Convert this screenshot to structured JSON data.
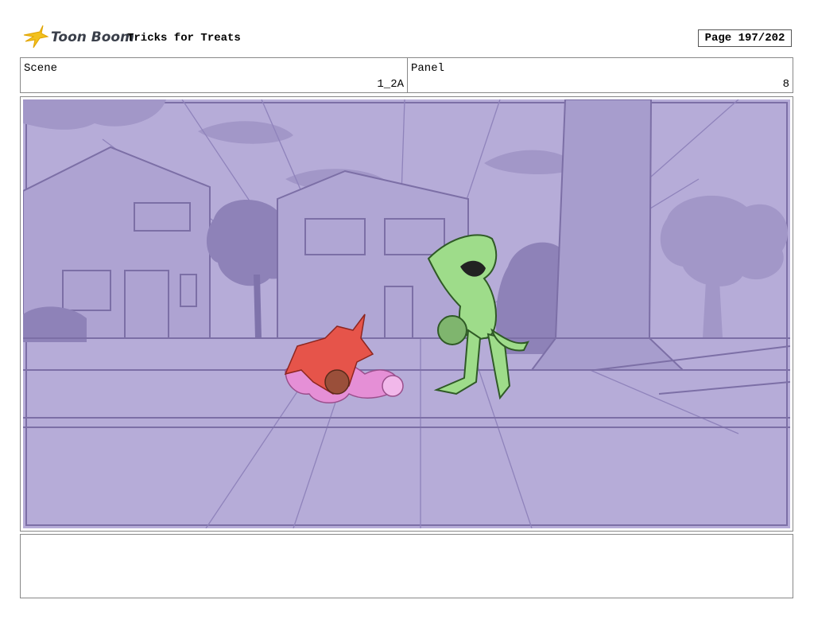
{
  "header": {
    "logo_text": "Toon Boom",
    "title": "Tricks for Treats",
    "page_indicator": "Page 197/202"
  },
  "scene": {
    "label": "Scene",
    "value": "1_2A"
  },
  "panel": {
    "label": "Panel",
    "value": "8"
  },
  "notes": {
    "text": ""
  },
  "colors": {
    "background": "#b6acd8",
    "line": "#7c6fa6",
    "imp": "#e6544a",
    "fairy": "#e58fd6",
    "croc": "#9edc8a"
  }
}
